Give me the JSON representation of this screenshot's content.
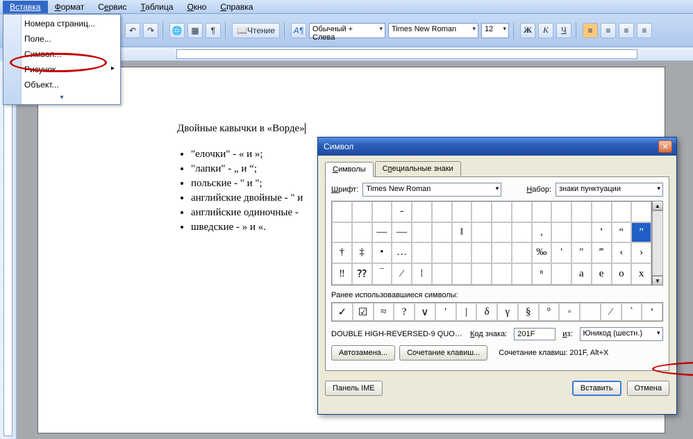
{
  "menubar": {
    "insert": "Вставка",
    "format": "Формат",
    "service": "Сервис",
    "table": "Таблица",
    "window": "Окно",
    "help": "Справка"
  },
  "insert_menu": {
    "page_numbers": "Номера страниц...",
    "field": "Поле...",
    "symbol": "Символ...",
    "picture": "Рисунок",
    "object": "Объект..."
  },
  "toolbar": {
    "reading": "Чтение",
    "style": "Обычный + Слева",
    "font": "Times New Roman",
    "size": "12",
    "bold": "Ж",
    "italic": "К",
    "underline": "Ч"
  },
  "document": {
    "title": "Двойные кавычки в «Ворде»",
    "items": [
      "\"елочки\" - « и »;",
      "\"лапки\" - „ и “;",
      "польские - \" и \";",
      "английские двойные - \" и",
      "английские одиночные -",
      "шведские - » и «."
    ]
  },
  "dialog": {
    "title": "Символ",
    "tab_symbols": "Символы",
    "tab_special": "Специальные знаки",
    "font_label": "Шрифт:",
    "font_value": "Times New Roman",
    "subset_label": "Набор:",
    "subset_value": "знаки пунктуации",
    "recent_label": "Ранее использовавшиеся символы:",
    "char_name": "DOUBLE HIGH-REVERSED-9 QUOTA...",
    "code_label": "Код знака:",
    "code_value": "201F",
    "from_label": "из:",
    "from_value": "Юникод (шестн.)",
    "autocorrect": "Автозамена...",
    "shortcut_btn": "Сочетание клавиш...",
    "shortcut_text": "Сочетание клавиш: 201F, Alt+X",
    "ime": "Панель IME",
    "insert": "Вставить",
    "cancel": "Отмена",
    "grid_rows": [
      [
        "",
        "",
        "",
        "‐",
        "",
        "",
        "",
        "",
        "",
        "",
        "",
        "",
        "",
        "",
        "",
        ""
      ],
      [
        "",
        "",
        "—",
        "―",
        "",
        "",
        "‖",
        "",
        "",
        "",
        "‚",
        "",
        "",
        "‛",
        "“",
        "”"
      ],
      [
        "†",
        "‡",
        "•",
        "…",
        "",
        "",
        "",
        "",
        "",
        "",
        "‰",
        "′",
        "″",
        "‴",
        "‹",
        "›"
      ],
      [
        "‼",
        "⁇",
        "‾",
        "⁄",
        "⁞",
        "",
        "",
        "",
        "",
        "",
        "ⁿ",
        "",
        "",
        "",
        "",
        ""
      ]
    ],
    "row3_sub": [
      "a",
      "e",
      "o",
      "x"
    ],
    "selected_cell": "‛",
    "recent": [
      "✓",
      "☑",
      "≈",
      "?",
      "∨",
      "′",
      "|",
      "δ",
      "γ",
      "§",
      "°",
      "◦",
      "",
      "⁄",
      "`",
      "ʻ"
    ]
  }
}
